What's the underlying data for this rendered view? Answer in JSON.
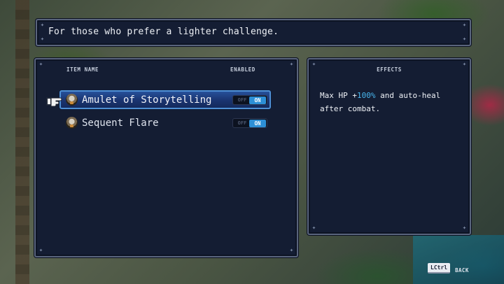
{
  "description": "For those who prefer a lighter challenge.",
  "items_panel": {
    "header_name": "ITEM NAME",
    "header_enabled": "ENABLED",
    "items": [
      {
        "label": "Amulet of Storytelling",
        "icon": "amulet-icon",
        "toggle_off": "OFF",
        "toggle_on": "ON",
        "enabled": true,
        "selected": true
      },
      {
        "label": "Sequent Flare",
        "icon": "flare-icon",
        "toggle_off": "OFF",
        "toggle_on": "ON",
        "enabled": true,
        "selected": false
      }
    ]
  },
  "effects_panel": {
    "header": "EFFECTS",
    "text_before": "Max HP +",
    "text_highlight": "100%",
    "text_after": " and auto-heal after combat."
  },
  "footer": {
    "key": "LCtrl",
    "back_label": "BACK"
  },
  "colors": {
    "panel_bg": "#141d33",
    "panel_border": "#59647d",
    "selected_row": "#1a3470",
    "toggle_on": "#2d8fd6",
    "highlight_text": "#48b6ee"
  },
  "icons": {
    "pointer": "pointing-hand-icon",
    "corner": "corner-ornament-icon"
  }
}
